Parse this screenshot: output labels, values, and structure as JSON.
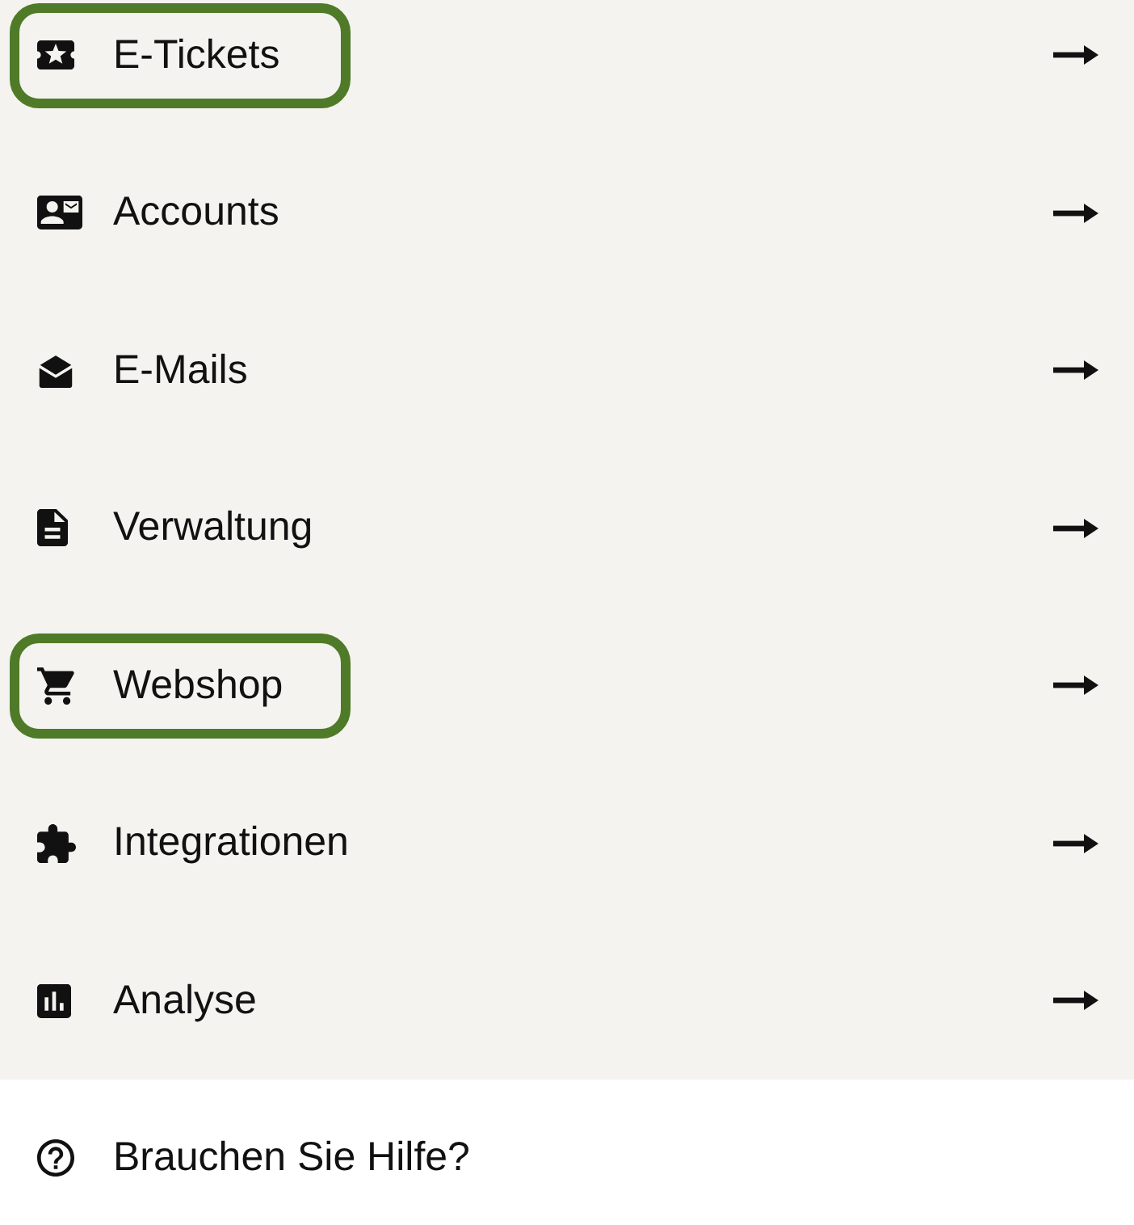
{
  "menu": {
    "items": [
      {
        "label": "E-Tickets",
        "highlighted": true
      },
      {
        "label": "Accounts",
        "highlighted": false
      },
      {
        "label": "E-Mails",
        "highlighted": false
      },
      {
        "label": "Verwaltung",
        "highlighted": false
      },
      {
        "label": "Webshop",
        "highlighted": true
      },
      {
        "label": "Integrationen",
        "highlighted": false
      },
      {
        "label": "Analyse",
        "highlighted": false
      }
    ]
  },
  "help_link": {
    "label": "Brauchen Sie Hilfe?"
  }
}
